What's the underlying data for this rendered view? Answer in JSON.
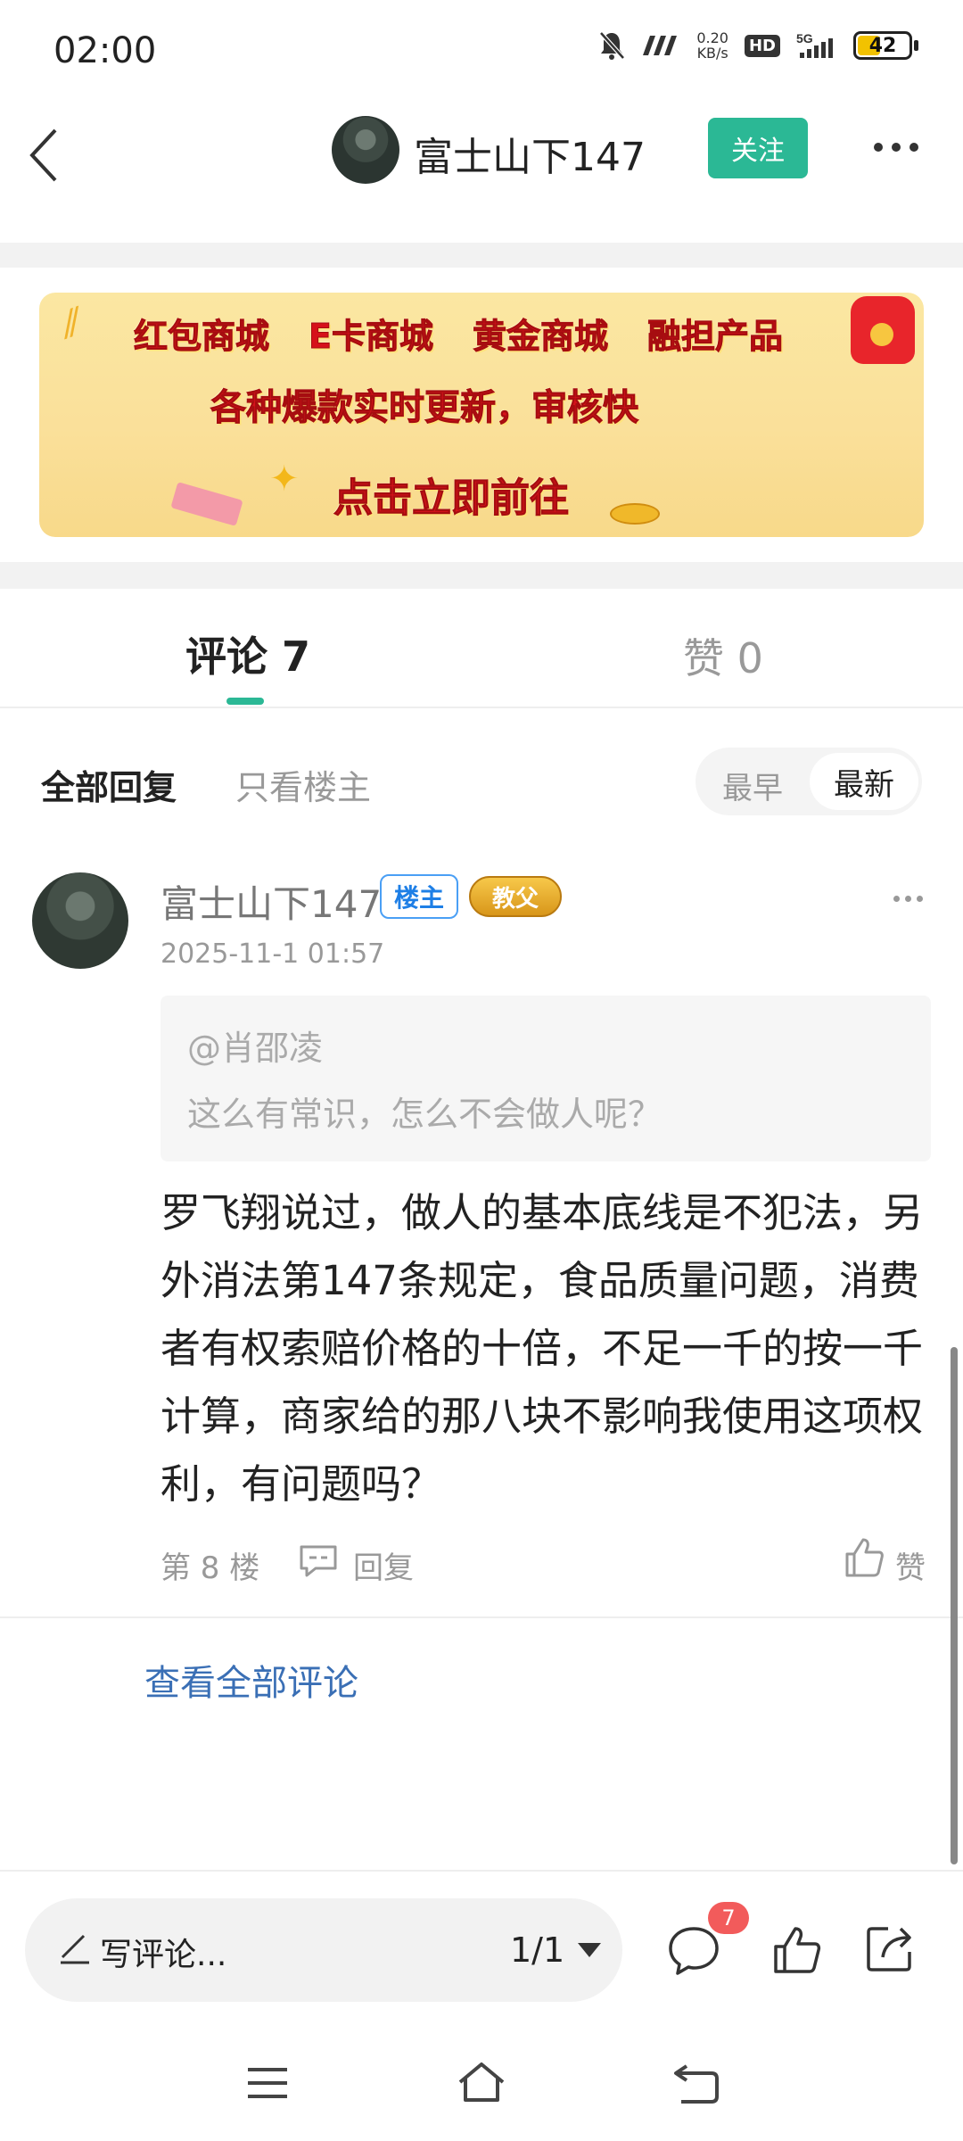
{
  "status_bar": {
    "time": "02:00",
    "net_speed_value": "0.20",
    "net_speed_unit": "KB/s",
    "hd": "HD",
    "network": "5G",
    "battery": "42"
  },
  "header": {
    "title": "富士山下147",
    "follow_label": "关注"
  },
  "banner": {
    "items": [
      "红包商城",
      "E卡商城",
      "黄金商城",
      "融担产品"
    ],
    "tagline": "各种爆款实时更新，审核快",
    "cta": "点击立即前往"
  },
  "tabs": {
    "comments": "评论 7",
    "likes": "赞 0"
  },
  "filters": {
    "all": "全部回复",
    "op_only": "只看楼主",
    "sort_earliest": "最早",
    "sort_latest": "最新",
    "selected_sort": "最新"
  },
  "comment": {
    "author": "富士山下147",
    "op_badge": "楼主",
    "rank_badge": "教父",
    "time": "2025-11-1 01:57",
    "quote_at": "@肖邵凌",
    "quote_text": "这么有常识，怎么不会做人呢？",
    "body": "罗飞翔说过，做人的基本底线是不犯法，另外消法第147条规定，食品质量问题，消费者有权索赔价格的十倍，不足一千的按一千计算，商家给的那八块不影响我使用这项权利，有问题吗？",
    "floor": "第 8 楼",
    "reply_label": "回复",
    "like_label": "赞"
  },
  "view_all": "查看全部评论",
  "toolbar": {
    "write_placeholder": "写评论...",
    "page": "1/1",
    "comment_count": "7"
  },
  "colors": {
    "accent": "#2bb895",
    "link": "#3a6fb5",
    "badge_red": "#f25b5b"
  }
}
